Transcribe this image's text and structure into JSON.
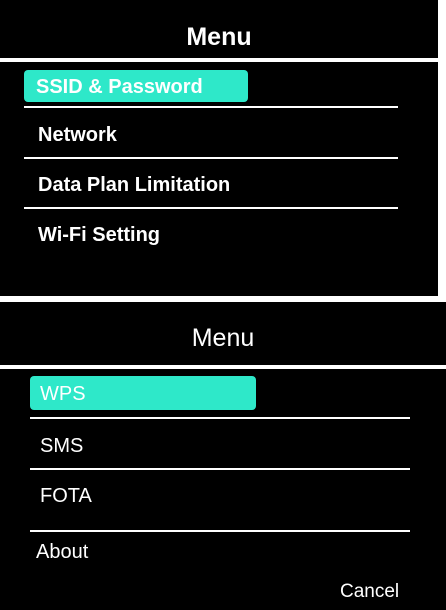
{
  "top_screen": {
    "title": "Menu",
    "items": [
      {
        "label": "SSID & Password",
        "selected": true
      },
      {
        "label": "Network",
        "selected": false
      },
      {
        "label": "Data Plan Limitation",
        "selected": false
      },
      {
        "label": "Wi-Fi Setting",
        "selected": false
      }
    ]
  },
  "bottom_screen": {
    "title": "Menu",
    "items": [
      {
        "label": "WPS",
        "selected": true
      },
      {
        "label": "SMS",
        "selected": false
      },
      {
        "label": "FOTA",
        "selected": false
      },
      {
        "label": "About",
        "selected": false
      }
    ],
    "cancel_label": "Cancel"
  },
  "colors": {
    "highlight": "#2ee8c9",
    "background": "#000000",
    "text": "#ffffff"
  }
}
